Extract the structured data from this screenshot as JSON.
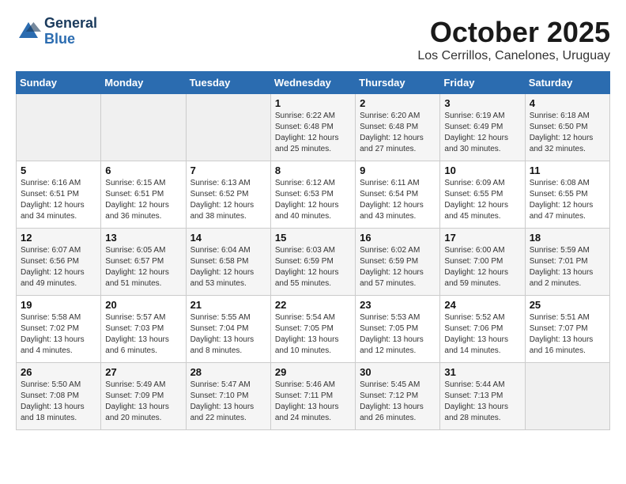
{
  "header": {
    "logo_line1": "General",
    "logo_line2": "Blue",
    "month": "October 2025",
    "location": "Los Cerrillos, Canelones, Uruguay"
  },
  "weekdays": [
    "Sunday",
    "Monday",
    "Tuesday",
    "Wednesday",
    "Thursday",
    "Friday",
    "Saturday"
  ],
  "weeks": [
    [
      {
        "day": "",
        "content": ""
      },
      {
        "day": "",
        "content": ""
      },
      {
        "day": "",
        "content": ""
      },
      {
        "day": "1",
        "content": "Sunrise: 6:22 AM\nSunset: 6:48 PM\nDaylight: 12 hours\nand 25 minutes."
      },
      {
        "day": "2",
        "content": "Sunrise: 6:20 AM\nSunset: 6:48 PM\nDaylight: 12 hours\nand 27 minutes."
      },
      {
        "day": "3",
        "content": "Sunrise: 6:19 AM\nSunset: 6:49 PM\nDaylight: 12 hours\nand 30 minutes."
      },
      {
        "day": "4",
        "content": "Sunrise: 6:18 AM\nSunset: 6:50 PM\nDaylight: 12 hours\nand 32 minutes."
      }
    ],
    [
      {
        "day": "5",
        "content": "Sunrise: 6:16 AM\nSunset: 6:51 PM\nDaylight: 12 hours\nand 34 minutes."
      },
      {
        "day": "6",
        "content": "Sunrise: 6:15 AM\nSunset: 6:51 PM\nDaylight: 12 hours\nand 36 minutes."
      },
      {
        "day": "7",
        "content": "Sunrise: 6:13 AM\nSunset: 6:52 PM\nDaylight: 12 hours\nand 38 minutes."
      },
      {
        "day": "8",
        "content": "Sunrise: 6:12 AM\nSunset: 6:53 PM\nDaylight: 12 hours\nand 40 minutes."
      },
      {
        "day": "9",
        "content": "Sunrise: 6:11 AM\nSunset: 6:54 PM\nDaylight: 12 hours\nand 43 minutes."
      },
      {
        "day": "10",
        "content": "Sunrise: 6:09 AM\nSunset: 6:55 PM\nDaylight: 12 hours\nand 45 minutes."
      },
      {
        "day": "11",
        "content": "Sunrise: 6:08 AM\nSunset: 6:55 PM\nDaylight: 12 hours\nand 47 minutes."
      }
    ],
    [
      {
        "day": "12",
        "content": "Sunrise: 6:07 AM\nSunset: 6:56 PM\nDaylight: 12 hours\nand 49 minutes."
      },
      {
        "day": "13",
        "content": "Sunrise: 6:05 AM\nSunset: 6:57 PM\nDaylight: 12 hours\nand 51 minutes."
      },
      {
        "day": "14",
        "content": "Sunrise: 6:04 AM\nSunset: 6:58 PM\nDaylight: 12 hours\nand 53 minutes."
      },
      {
        "day": "15",
        "content": "Sunrise: 6:03 AM\nSunset: 6:59 PM\nDaylight: 12 hours\nand 55 minutes."
      },
      {
        "day": "16",
        "content": "Sunrise: 6:02 AM\nSunset: 6:59 PM\nDaylight: 12 hours\nand 57 minutes."
      },
      {
        "day": "17",
        "content": "Sunrise: 6:00 AM\nSunset: 7:00 PM\nDaylight: 12 hours\nand 59 minutes."
      },
      {
        "day": "18",
        "content": "Sunrise: 5:59 AM\nSunset: 7:01 PM\nDaylight: 13 hours\nand 2 minutes."
      }
    ],
    [
      {
        "day": "19",
        "content": "Sunrise: 5:58 AM\nSunset: 7:02 PM\nDaylight: 13 hours\nand 4 minutes."
      },
      {
        "day": "20",
        "content": "Sunrise: 5:57 AM\nSunset: 7:03 PM\nDaylight: 13 hours\nand 6 minutes."
      },
      {
        "day": "21",
        "content": "Sunrise: 5:55 AM\nSunset: 7:04 PM\nDaylight: 13 hours\nand 8 minutes."
      },
      {
        "day": "22",
        "content": "Sunrise: 5:54 AM\nSunset: 7:05 PM\nDaylight: 13 hours\nand 10 minutes."
      },
      {
        "day": "23",
        "content": "Sunrise: 5:53 AM\nSunset: 7:05 PM\nDaylight: 13 hours\nand 12 minutes."
      },
      {
        "day": "24",
        "content": "Sunrise: 5:52 AM\nSunset: 7:06 PM\nDaylight: 13 hours\nand 14 minutes."
      },
      {
        "day": "25",
        "content": "Sunrise: 5:51 AM\nSunset: 7:07 PM\nDaylight: 13 hours\nand 16 minutes."
      }
    ],
    [
      {
        "day": "26",
        "content": "Sunrise: 5:50 AM\nSunset: 7:08 PM\nDaylight: 13 hours\nand 18 minutes."
      },
      {
        "day": "27",
        "content": "Sunrise: 5:49 AM\nSunset: 7:09 PM\nDaylight: 13 hours\nand 20 minutes."
      },
      {
        "day": "28",
        "content": "Sunrise: 5:47 AM\nSunset: 7:10 PM\nDaylight: 13 hours\nand 22 minutes."
      },
      {
        "day": "29",
        "content": "Sunrise: 5:46 AM\nSunset: 7:11 PM\nDaylight: 13 hours\nand 24 minutes."
      },
      {
        "day": "30",
        "content": "Sunrise: 5:45 AM\nSunset: 7:12 PM\nDaylight: 13 hours\nand 26 minutes."
      },
      {
        "day": "31",
        "content": "Sunrise: 5:44 AM\nSunset: 7:13 PM\nDaylight: 13 hours\nand 28 minutes."
      },
      {
        "day": "",
        "content": ""
      }
    ]
  ]
}
